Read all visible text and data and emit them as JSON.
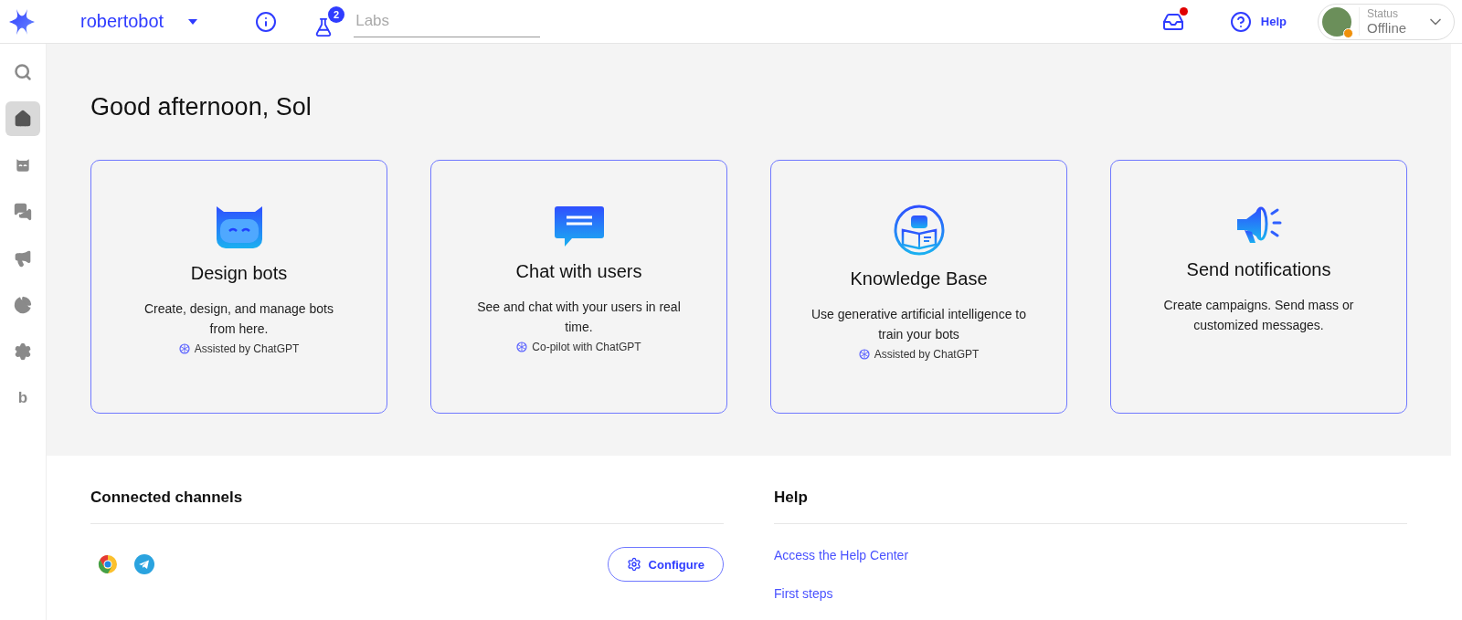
{
  "topbar": {
    "bot_name": "robertobot",
    "labs": {
      "badge": "2",
      "placeholder": "Labs"
    },
    "inbox": {
      "unread": true
    },
    "help": "Help",
    "status": {
      "label": "Status",
      "value": "Offline"
    }
  },
  "sidebar": {
    "items": [
      {
        "kind": "search",
        "selected": false
      },
      {
        "kind": "home",
        "selected": true
      },
      {
        "kind": "bots",
        "selected": false
      },
      {
        "kind": "chat",
        "selected": false
      },
      {
        "kind": "campaigns",
        "selected": false
      },
      {
        "kind": "analytics",
        "selected": false
      },
      {
        "kind": "settings",
        "selected": false
      },
      {
        "kind": "letter",
        "label": "b",
        "selected": false
      }
    ]
  },
  "greeting": "Good afternoon, Sol",
  "cards": [
    {
      "kind": "bots",
      "title": "Design bots",
      "description": "Create, design, and manage bots from here.",
      "note": "Assisted by ChatGPT"
    },
    {
      "kind": "chat",
      "title": "Chat with users",
      "description": "See and chat with your users in real time.",
      "note": "Co-pilot with ChatGPT"
    },
    {
      "kind": "knowledge",
      "title": "Knowledge Base",
      "description": "Use generative artificial intelligence to train your bots",
      "note": "Assisted by ChatGPT"
    },
    {
      "kind": "notifications",
      "title": "Send notifications",
      "description": "Create campaigns. Send mass or customized messages."
    }
  ],
  "channels": {
    "title": "Connected channels",
    "items": [
      {
        "kind": "chrome"
      },
      {
        "kind": "telegram"
      }
    ],
    "button": "Configure"
  },
  "help": {
    "title": "Help",
    "links": [
      "Access the Help Center",
      "First steps"
    ]
  }
}
